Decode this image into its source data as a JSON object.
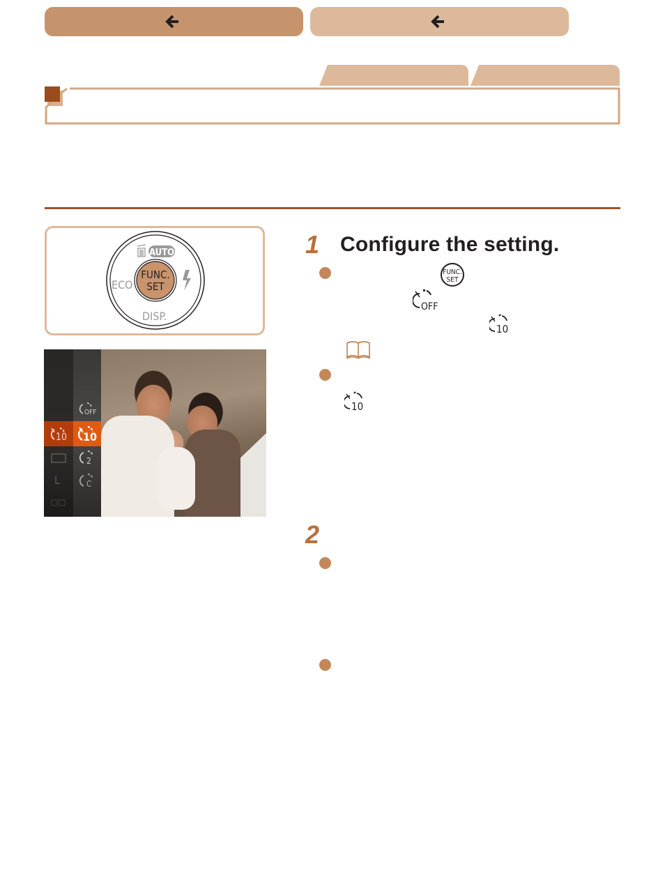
{
  "nav": {
    "prev_button": {
      "icon": "arrow-left-icon",
      "label": ""
    },
    "back_button": {
      "icon": "arrow-left-icon",
      "label": ""
    }
  },
  "tabs": [
    {
      "label": ""
    },
    {
      "label": ""
    }
  ],
  "section": {
    "title": ""
  },
  "colors": {
    "accent_dark": "#9a5424",
    "accent": "#c6946c",
    "accent_light": "#ddb99b",
    "bullet": "#c4875a",
    "lcd_highlight": "#e25a12"
  },
  "dial": {
    "center_top": "FUNC.",
    "center_bottom": "SET",
    "top_label": "AUTO",
    "left_label": "ECO",
    "bottom_label": "DISP.",
    "right_icon": "flash-icon",
    "top_left_icon": "trash-icon"
  },
  "lcd": {
    "left_column": [
      {
        "label": "10",
        "icon": "self-timer-10-icon",
        "selected": true
      },
      {
        "label": "",
        "icon": "aspect-ratio-icon",
        "selected": false
      },
      {
        "label": "L",
        "icon": "image-size-icon",
        "selected": false
      }
    ],
    "right_column": [
      {
        "label": "OFF",
        "icon": "self-timer-off-icon",
        "selected": false
      },
      {
        "label": "10",
        "icon": "self-timer-10-icon",
        "selected": true
      },
      {
        "label": "2",
        "icon": "self-timer-2-icon",
        "selected": false
      },
      {
        "label": "C",
        "icon": "self-timer-custom-icon",
        "selected": false
      }
    ]
  },
  "steps": [
    {
      "number": "1",
      "title": "Configure the setting.",
      "bullets": [
        {
          "icons": [
            "func-set-button-icon",
            "self-timer-off-icon",
            "self-timer-10-icon",
            "page-reference-book-icon"
          ]
        },
        {
          "icons": [
            "self-timer-10-icon"
          ]
        }
      ]
    },
    {
      "number": "2",
      "title": "",
      "bullets": [
        {},
        {}
      ]
    }
  ],
  "icon_text": {
    "func": "FUNC.",
    "set": "SET",
    "off": "OFF",
    "ten": "10"
  }
}
